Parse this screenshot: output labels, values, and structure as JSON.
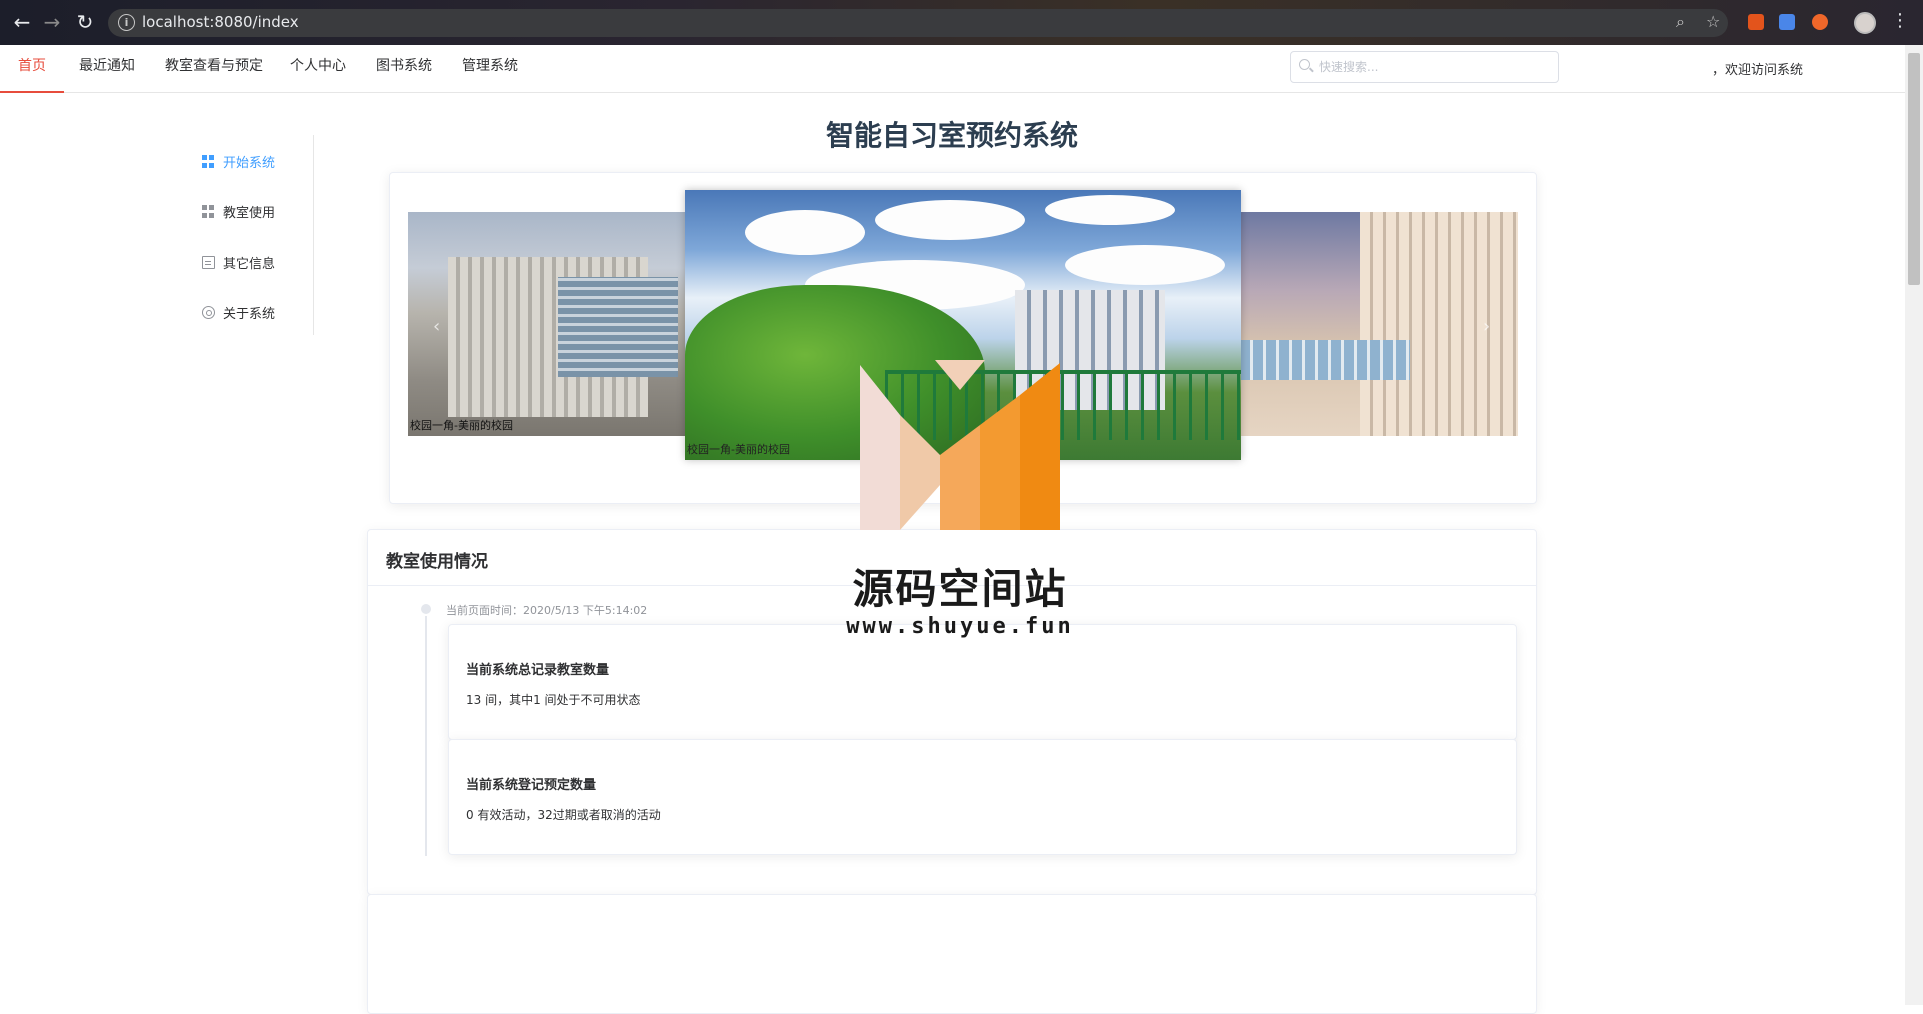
{
  "browser": {
    "url": "localhost:8080/index",
    "accent": "#e74c3c"
  },
  "topmenu": {
    "items": [
      "首页",
      "最近通知",
      "教室查看与预定",
      "个人中心",
      "图书系统",
      "管理系统"
    ],
    "active_index": 0,
    "search_placeholder": "快速搜索...",
    "welcome": "，欢迎访问系统"
  },
  "sidebar": {
    "items": [
      {
        "label": "开始系统",
        "icon": "grid-icon",
        "active": true
      },
      {
        "label": "教室使用",
        "icon": "grid-icon",
        "active": false
      },
      {
        "label": "其它信息",
        "icon": "document-icon",
        "active": false
      },
      {
        "label": "关于系统",
        "icon": "gear-icon",
        "active": false
      }
    ]
  },
  "main": {
    "title": "智能自习室预约系统",
    "carousel": {
      "left_caption": "校园一角-美丽的校园",
      "center_caption": "校园一角-美丽的校园",
      "prev_icon": "chevron-left-icon",
      "next_icon": "chevron-right-icon"
    },
    "usage": {
      "title": "教室使用情况",
      "timestamp": "当前页面时间：2020/5/13 下午5:14:02",
      "stats": [
        {
          "title": "当前系统总记录教室数量",
          "value": "13 间，其中1 间处于不可用状态"
        },
        {
          "title": "当前系统登记预定数量",
          "value": "0 有效活动，32过期或者取消的活动"
        }
      ]
    }
  },
  "watermark": {
    "text": "源码空间站",
    "url": "www.shuyue.fun"
  }
}
